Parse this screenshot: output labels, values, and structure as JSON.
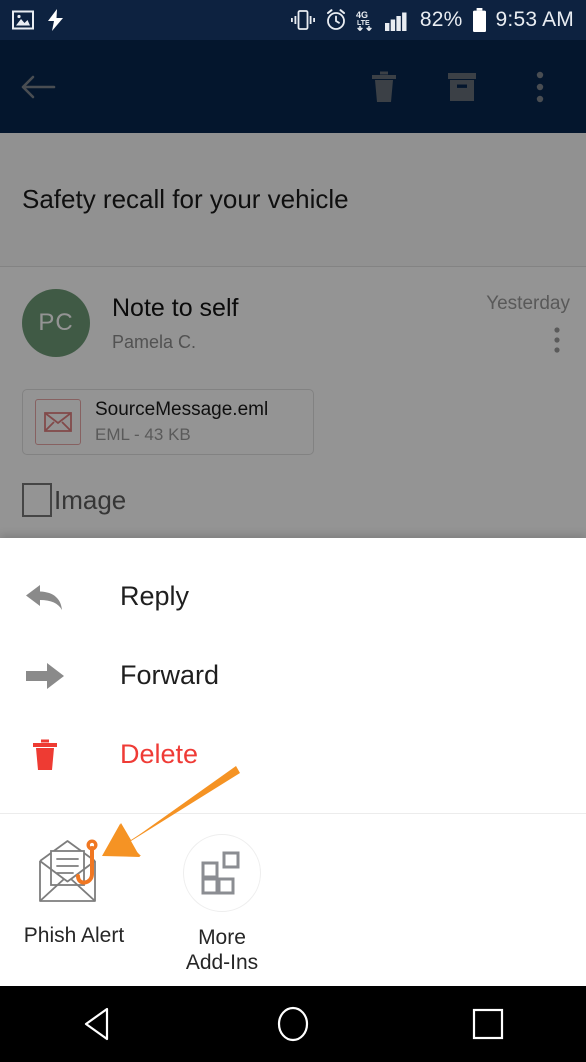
{
  "status_bar": {
    "background": "#0d2240",
    "battery_percent": "82%",
    "time": "9:53 AM",
    "icons_left": [
      "image-icon",
      "flash-icon"
    ],
    "icons_right": [
      "vibrate-icon",
      "alarm-icon",
      "4g-lte-icon",
      "signal-bars-icon",
      "battery-icon"
    ],
    "network_label_top": "4G",
    "network_label_bottom": "LTE"
  },
  "app_bar": {
    "background": "#0a3161",
    "back_label": "back-arrow",
    "actions": [
      {
        "name": "delete-button",
        "icon": "trash-icon"
      },
      {
        "name": "archive-button",
        "icon": "archive-icon"
      },
      {
        "name": "overflow-button",
        "icon": "kebab-menu-icon"
      }
    ]
  },
  "email": {
    "subject": "Safety recall for your vehicle",
    "avatar_initials": "PC",
    "avatar_color": "#6f9c78",
    "sender_title": "Note to self",
    "sender_name": "Pamela C.",
    "date": "Yesterday",
    "attachment": {
      "filename": "SourceMessage.eml",
      "meta": "EML - 43 KB",
      "icon": "envelope-attachment-icon"
    },
    "image_placeholder_label": "Image"
  },
  "sheet": {
    "items": [
      {
        "label": "Reply",
        "icon": "reply-arrow-icon",
        "danger": false
      },
      {
        "label": "Forward",
        "icon": "forward-arrow-icon",
        "danger": false
      },
      {
        "label": "Delete",
        "icon": "trash-icon",
        "danger": true
      }
    ],
    "addins": [
      {
        "label": "Phish Alert",
        "icon": "phish-hook-envelope-icon",
        "circled": false
      },
      {
        "label": "More\nAdd-Ins",
        "icon": "addins-grid-icon",
        "circled": true
      }
    ]
  },
  "annotation": {
    "color": "#f59324",
    "shape": "arrow-pointing-to-phish-alert"
  },
  "nav_bar": {
    "background": "#000000",
    "buttons": [
      {
        "name": "nav-back-button",
        "icon": "triangle-left-icon"
      },
      {
        "name": "nav-home-button",
        "icon": "circle-icon"
      },
      {
        "name": "nav-recents-button",
        "icon": "square-icon"
      }
    ]
  }
}
